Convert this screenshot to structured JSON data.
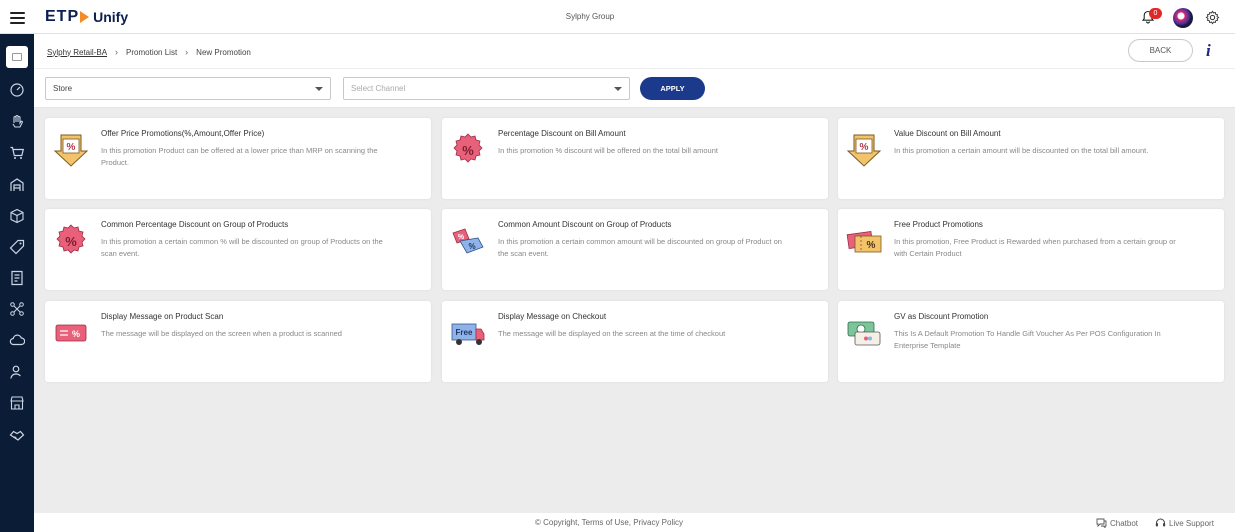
{
  "header": {
    "brand_main": "ETP",
    "brand_sub": "Unify",
    "org_name": "Sylphy Group",
    "notification_count": "0"
  },
  "breadcrumb": {
    "items": [
      "Sylphy Retail-BA",
      "Promotion List",
      "New Promotion"
    ]
  },
  "actions": {
    "back_label": "BACK",
    "info_label": "i"
  },
  "filters": {
    "store_value": "Store",
    "channel_placeholder": "Select Channel",
    "apply_label": "APPLY"
  },
  "promotions": [
    {
      "title": "Offer Price Promotions(%,Amount,Offer Price)",
      "desc": "In this promotion Product can be offered at a lower price than MRP on scanning the Product.",
      "icon": "percent-arrow-down-icon"
    },
    {
      "title": "Percentage Discount on Bill Amount",
      "desc": "In this promotion % discount will be offered on the total bill amount",
      "icon": "percent-badge-icon"
    },
    {
      "title": "Value Discount on Bill Amount",
      "desc": "In this promotion a certain amount will be discounted on the total bill amount.",
      "icon": "percent-arrow-down-icon"
    },
    {
      "title": "Common Percentage Discount on Group of Products",
      "desc": "In this promotion a certain common % will be discounted on group of Products on the scan event.",
      "icon": "percent-badge-icon"
    },
    {
      "title": "Common Amount Discount on Group of Products",
      "desc": "In this promotion a certain common amount will be discounted on group of Product on the scan event.",
      "icon": "discount-tags-icon"
    },
    {
      "title": "Free Product Promotions",
      "desc": "In this promotion, Free Product is Rewarded when purchased from a certain group or with Certain Product",
      "icon": "coupon-ticket-icon"
    },
    {
      "title": "Display Message on Product Scan",
      "desc": "The message will be displayed on the screen when a product is scanned",
      "icon": "message-card-icon"
    },
    {
      "title": "Display Message on Checkout",
      "desc": "The message will be displayed on the screen at the time of checkout",
      "icon": "free-truck-icon"
    },
    {
      "title": "GV as Discount Promotion",
      "desc": "This Is A Default Promotion To Handle Gift Voucher As Per POS Configuration In Enterprise Template",
      "icon": "gift-voucher-icon"
    }
  ],
  "icon_text": {
    "percent": "%",
    "free": "Free"
  },
  "footer": {
    "copyright": "© Copyright, Terms of Use, Privacy Policy",
    "chatbot_label": "Chatbot",
    "support_label": "Live Support"
  },
  "colors": {
    "primary": "#1c3a8c",
    "sidebar": "#0b1d36",
    "badge": "#e02828",
    "pink": "#e8607a",
    "gold": "#f2c36b"
  }
}
